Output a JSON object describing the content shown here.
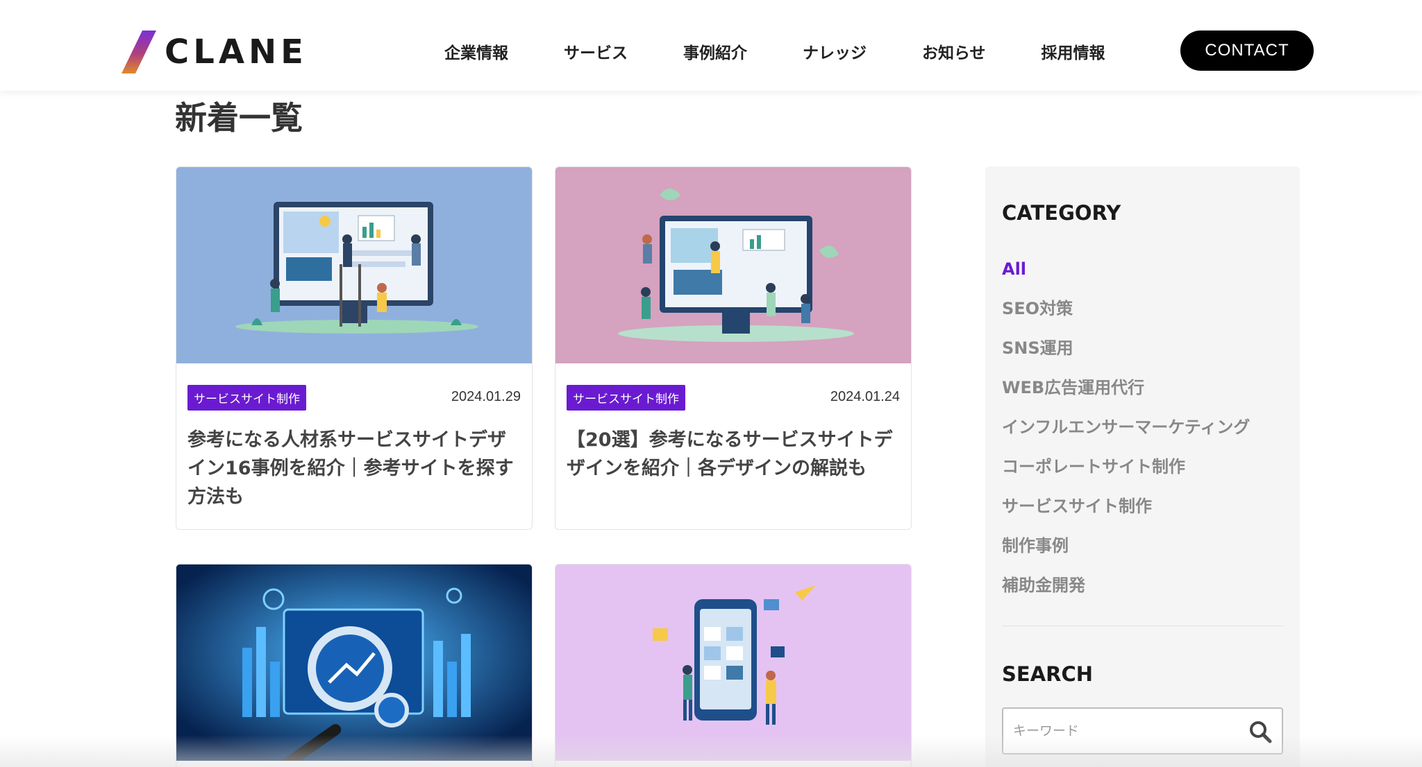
{
  "header": {
    "logo_text": "CLANE",
    "nav": [
      "企業情報",
      "サービス",
      "事例紹介",
      "ナレッジ",
      "お知らせ",
      "採用情報"
    ],
    "contact_label": "CONTACT"
  },
  "main": {
    "title": "新着一覧",
    "articles": [
      {
        "tag": "サービスサイト制作",
        "date": "2024.01.29",
        "title": "参考になる人材系サービスサイトデザイン16事例を紹介｜参考サイトを探す方法も"
      },
      {
        "tag": "サービスサイト制作",
        "date": "2024.01.24",
        "title": "【20選】参考になるサービスサイトデザインを紹介｜各デザインの解説も"
      }
    ]
  },
  "sidebar": {
    "category_heading": "CATEGORY",
    "categories": [
      "All",
      "SEO対策",
      "SNS運用",
      "WEB広告運用代行",
      "インフルエンサーマーケティング",
      "コーポレートサイト制作",
      "サービスサイト制作",
      "制作事例",
      "補助金開発"
    ],
    "search_heading": "SEARCH",
    "search_placeholder": "キーワード"
  },
  "colors": {
    "accent": "#6a1bd1",
    "thumb_blue": "#8fb0dd",
    "thumb_pink": "#d5a2bf",
    "thumb_dark": "#0f3a7a",
    "thumb_lavender": "#e4c3f3"
  }
}
